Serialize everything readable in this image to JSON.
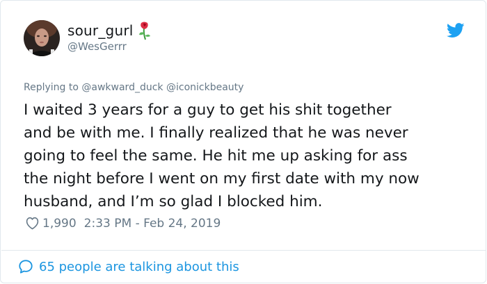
{
  "tweet": {
    "display_name": "sour_gurl",
    "handle": "@WesGerrr",
    "replying_prefix": "Replying to",
    "reply_mentions": [
      "@awkward_duck",
      "@iconickbeauty"
    ],
    "text": "I waited 3 years for a guy to get his shit together\nand be with me.  I finally realized that he was never\ngoing to feel the same.  He hit me up asking for ass\nthe night before I went on my first date with my now\nhusband, and I’m so glad I blocked him.",
    "like_count": "1,990",
    "timestamp": "2:33 PM - Feb 24, 2019",
    "talking_label": "65 people are talking about this"
  },
  "icons": {
    "brand": "twitter-bird-icon",
    "name_emoji": "wilted-rose-icon",
    "like": "heart-icon",
    "reply": "speech-bubble-icon"
  },
  "colors": {
    "twitter_blue": "#1da1f2",
    "link_blue": "#1b95e0",
    "secondary_text": "#657786",
    "primary_text": "#14171a",
    "border": "#e1e8ed"
  }
}
